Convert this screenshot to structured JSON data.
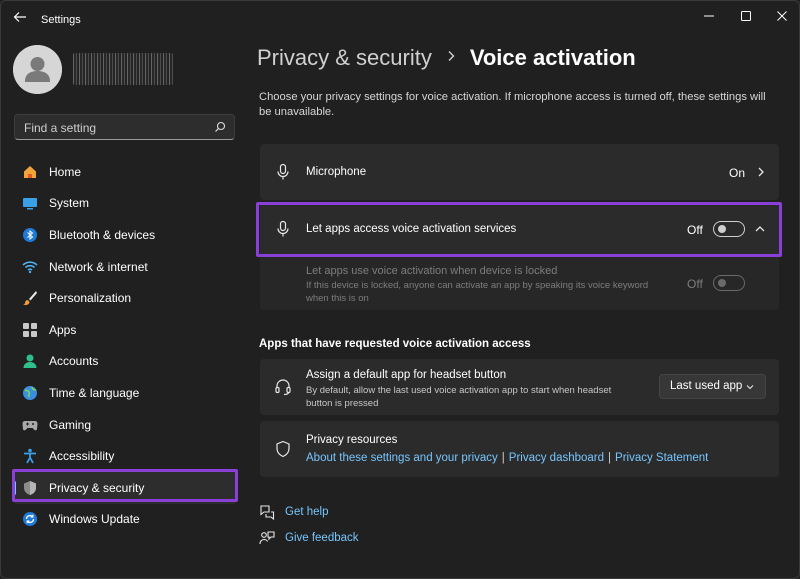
{
  "window": {
    "title": "Settings"
  },
  "sidebar": {
    "search_placeholder": "Find a setting",
    "items": [
      {
        "label": "Home",
        "icon": "home-icon"
      },
      {
        "label": "System",
        "icon": "system-icon"
      },
      {
        "label": "Bluetooth & devices",
        "icon": "bluetooth-icon"
      },
      {
        "label": "Network & internet",
        "icon": "network-icon"
      },
      {
        "label": "Personalization",
        "icon": "brush-icon"
      },
      {
        "label": "Apps",
        "icon": "apps-icon"
      },
      {
        "label": "Accounts",
        "icon": "accounts-icon"
      },
      {
        "label": "Time & language",
        "icon": "globe-icon"
      },
      {
        "label": "Gaming",
        "icon": "gaming-icon"
      },
      {
        "label": "Accessibility",
        "icon": "accessibility-icon"
      },
      {
        "label": "Privacy & security",
        "icon": "shield-icon",
        "active": true
      },
      {
        "label": "Windows Update",
        "icon": "update-icon"
      }
    ]
  },
  "main": {
    "breadcrumb_parent": "Privacy & security",
    "breadcrumb_current": "Voice activation",
    "description": "Choose your privacy settings for voice activation. If microphone access is turned off, these settings will be unavailable.",
    "microphone": {
      "title": "Microphone",
      "state": "On"
    },
    "let_apps": {
      "title": "Let apps access voice activation services",
      "state": "Off"
    },
    "locked": {
      "title": "Let apps use voice activation when device is locked",
      "subtitle": "If this device is locked, anyone can activate an app by speaking its voice keyword when this is on",
      "state": "Off"
    },
    "section_title": "Apps that have requested voice activation access",
    "headset": {
      "title": "Assign a default app for headset button",
      "subtitle": "By default, allow the last used voice activation app to start when headset button is pressed",
      "dropdown_value": "Last used app"
    },
    "privacy_resources": {
      "title": "Privacy resources",
      "link1": "About these settings and your privacy",
      "link2": "Privacy dashboard",
      "link3": "Privacy Statement",
      "separator": "|"
    },
    "help": {
      "get_help": "Get help",
      "give_feedback": "Give feedback"
    }
  },
  "colors": {
    "background": "#202020",
    "card": "#2b2b2b",
    "accent": "#60cdff",
    "link": "#76c6ff",
    "highlight": "#8a3fd6"
  }
}
